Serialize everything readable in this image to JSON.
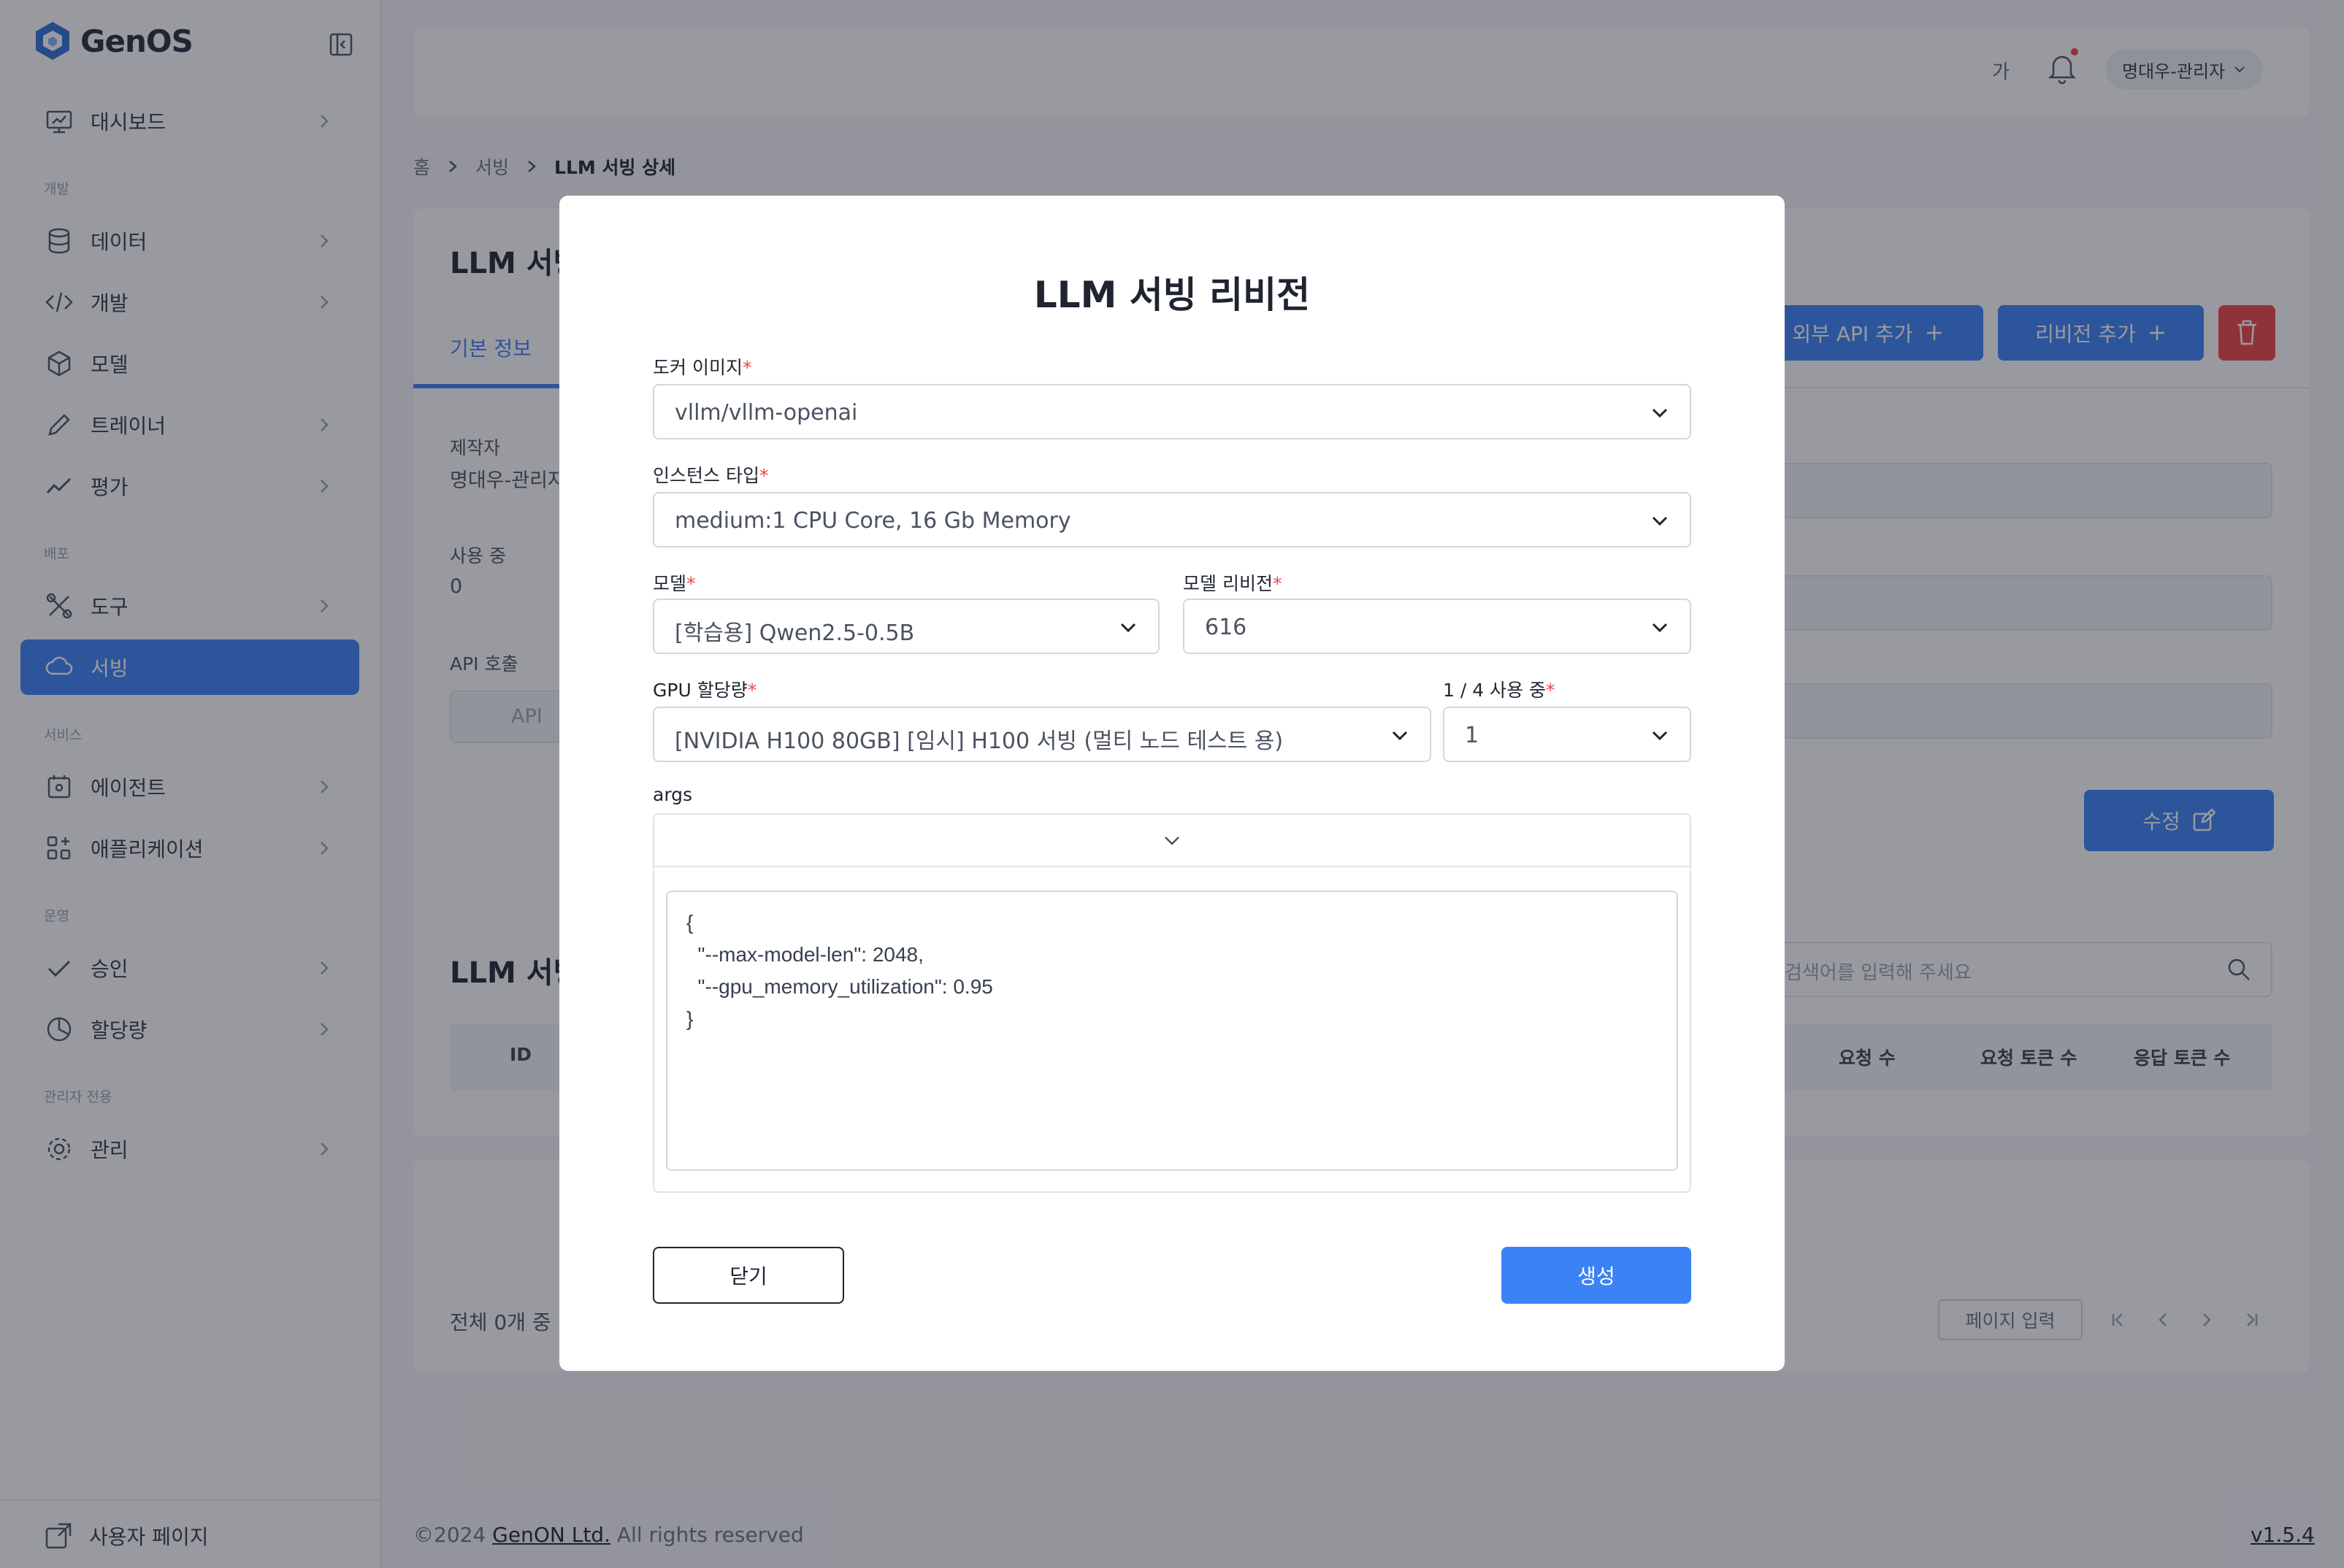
{
  "app": {
    "name": "GenOS"
  },
  "sidebar": {
    "items": [
      {
        "label": "대시보드",
        "icon": "monitor-icon"
      },
      {
        "label": "데이터",
        "icon": "database-icon"
      },
      {
        "label": "개발",
        "icon": "code-icon"
      },
      {
        "label": "모델",
        "icon": "cube-icon"
      },
      {
        "label": "트레이너",
        "icon": "pencil-icon"
      },
      {
        "label": "평가",
        "icon": "chart-line-icon"
      },
      {
        "label": "도구",
        "icon": "tools-icon"
      },
      {
        "label": "서빙",
        "icon": "cloud-icon"
      },
      {
        "label": "에이전트",
        "icon": "agent-icon"
      },
      {
        "label": "애플리케이션",
        "icon": "apps-icon"
      },
      {
        "label": "승인",
        "icon": "check-icon"
      },
      {
        "label": "할당량",
        "icon": "pie-icon"
      },
      {
        "label": "관리",
        "icon": "gear-icon"
      }
    ],
    "sections": [
      "개발",
      "배포",
      "서비스",
      "운영",
      "관리자 전용"
    ],
    "user_page": "사용자 페이지"
  },
  "header": {
    "lang": "가",
    "user": "명대우-관리자"
  },
  "breadcrumb": [
    "홈",
    "서빙",
    "LLM 서빙 상세"
  ],
  "page": {
    "title": "LLM 서빙",
    "tab_basic": "기본 정보",
    "external_api_button": "외부 API 추가",
    "add_revision_button": "리비전 추가",
    "creator_label": "제작자",
    "creator_value": "명대우-관리자",
    "in_use_label": "사용 중",
    "in_use_value": "0",
    "api_call_label": "API 호출",
    "api_placeholder": "API",
    "edit_button": "수정",
    "list_title": "LLM 서빙",
    "search_placeholder": "검색어를 입력해 주세요",
    "table_headers": {
      "id": "ID",
      "requests": "요청 수",
      "request_tokens": "요청 토큰 수",
      "response_tokens": "응답 토큰 수"
    },
    "total": "전체 0개 중",
    "page_input": "페이지 입력"
  },
  "footer": {
    "copyright": "©2024",
    "company": "GenON Ltd.",
    "rights": "All rights reserved",
    "version": "v1.5.4"
  },
  "modal": {
    "title": "LLM 서빙 리비전",
    "docker_image": {
      "label": "도커 이미지",
      "value": "vllm/vllm-openai"
    },
    "instance_type": {
      "label": "인스턴스 타입",
      "value": "medium:1 CPU Core, 16 Gb Memory"
    },
    "model": {
      "label": "모델",
      "value": "[학습용] Qwen2.5-0.5B"
    },
    "model_revision": {
      "label": "모델 리비전",
      "value": "616"
    },
    "gpu_alloc": {
      "label": "GPU 할당량",
      "value": "[NVIDIA H100 80GB] [임시] H100 서빙 (멀티 노드 테스트 용)"
    },
    "gpu_usage": {
      "label": "1 / 4 사용 중",
      "value": "1"
    },
    "args": {
      "label": "args",
      "code": "{\n  \"--max-model-len\": 2048,\n  \"--gpu_memory_utilization\": 0.95\n}"
    },
    "close_button": "닫기",
    "create_button": "생성"
  }
}
